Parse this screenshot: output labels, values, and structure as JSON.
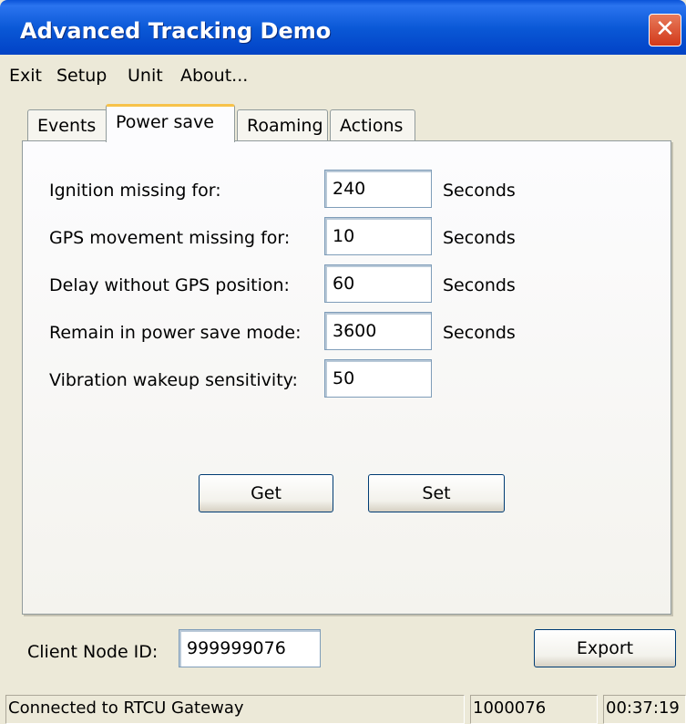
{
  "window": {
    "title": "Advanced Tracking Demo"
  },
  "menu": {
    "items": [
      "Exit",
      "Setup",
      "Unit",
      "About..."
    ]
  },
  "tabs": [
    "Events",
    "Power save",
    "Roaming",
    "Actions"
  ],
  "active_tab": "Power save",
  "power_save": {
    "rows": [
      {
        "label": "Ignition missing for:",
        "value": "240",
        "unit": "Seconds"
      },
      {
        "label": "GPS movement missing for:",
        "value": "10",
        "unit": "Seconds"
      },
      {
        "label": "Delay without GPS position:",
        "value": "60",
        "unit": "Seconds"
      },
      {
        "label": "Remain in power save mode:",
        "value": "3600",
        "unit": "Seconds"
      },
      {
        "label": "Vibration wakeup sensitivity:",
        "value": "50",
        "unit": ""
      }
    ],
    "get_label": "Get",
    "set_label": "Set"
  },
  "client": {
    "label": "Client Node ID:",
    "value": "999999076"
  },
  "export_label": "Export",
  "statusbar": {
    "connection": "Connected to RTCU Gateway",
    "node": "1000076",
    "time": "00:37:19"
  }
}
